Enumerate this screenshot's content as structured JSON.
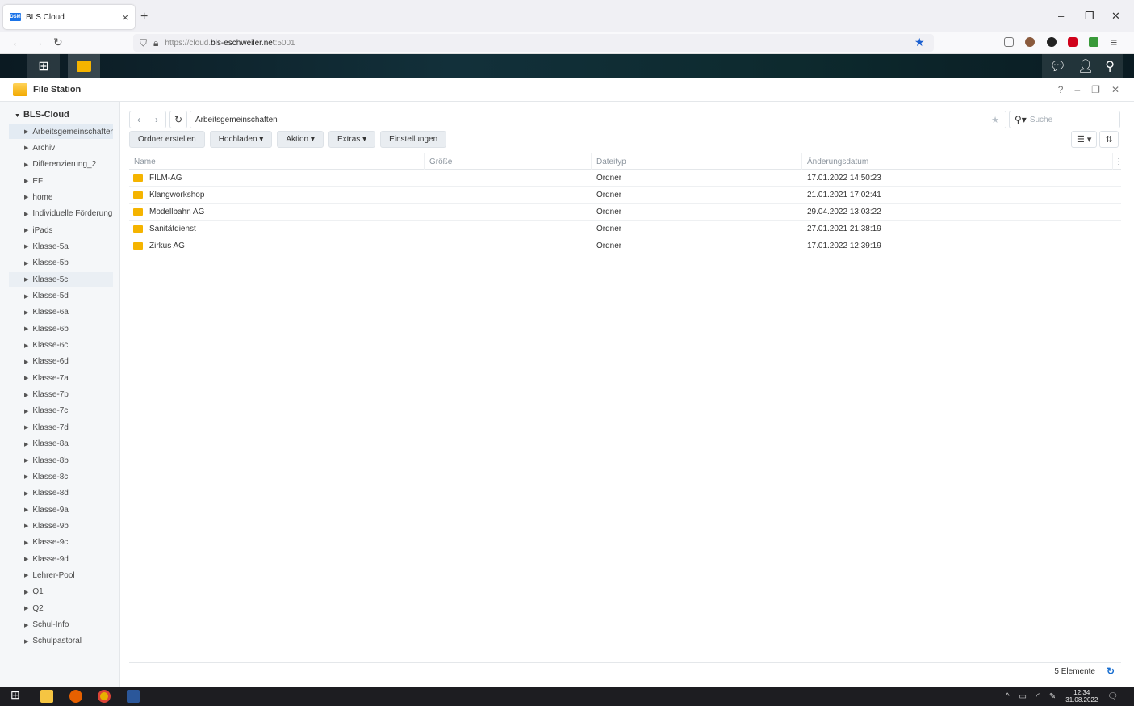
{
  "browser": {
    "tab_title": "BLS Cloud",
    "favicon_text": "DSM",
    "url_prefix": "https://cloud.",
    "url_host": "bls-eschweiler.net",
    "url_suffix": ":5001"
  },
  "app": {
    "title": "File Station"
  },
  "sidebar": {
    "root": "BLS-Cloud",
    "items": [
      "Arbeitsgemeinschaften",
      "Archiv",
      "Differenzierung_2",
      "EF",
      "home",
      "Individuelle Förderung",
      "iPads",
      "Klasse-5a",
      "Klasse-5b",
      "Klasse-5c",
      "Klasse-5d",
      "Klasse-6a",
      "Klasse-6b",
      "Klasse-6c",
      "Klasse-6d",
      "Klasse-7a",
      "Klasse-7b",
      "Klasse-7c",
      "Klasse-7d",
      "Klasse-8a",
      "Klasse-8b",
      "Klasse-8c",
      "Klasse-8d",
      "Klasse-9a",
      "Klasse-9b",
      "Klasse-9c",
      "Klasse-9d",
      "Lehrer-Pool",
      "Q1",
      "Q2",
      "Schul-Info",
      "Schulpastoral"
    ]
  },
  "path": "Arbeitsgemeinschaften",
  "search_placeholder": "Suche",
  "toolbar": {
    "create_folder": "Ordner erstellen",
    "upload": "Hochladen",
    "action": "Aktion",
    "extras": "Extras",
    "settings": "Einstellungen"
  },
  "columns": {
    "name": "Name",
    "size": "Größe",
    "type": "Dateityp",
    "date": "Änderungsdatum"
  },
  "files": [
    {
      "name": "FILM-AG",
      "type": "Ordner",
      "date": "17.01.2022 14:50:23"
    },
    {
      "name": "Klangworkshop",
      "type": "Ordner",
      "date": "21.01.2021 17:02:41"
    },
    {
      "name": "Modellbahn AG",
      "type": "Ordner",
      "date": "29.04.2022 13:03:22"
    },
    {
      "name": "Sanitätdienst",
      "type": "Ordner",
      "date": "27.01.2021 21:38:19"
    },
    {
      "name": "Zirkus AG",
      "type": "Ordner",
      "date": "17.01.2022 12:39:19"
    }
  ],
  "footer": {
    "count": "5 Elemente"
  },
  "taskbar": {
    "time": "12:34",
    "date": "31.08.2022"
  }
}
